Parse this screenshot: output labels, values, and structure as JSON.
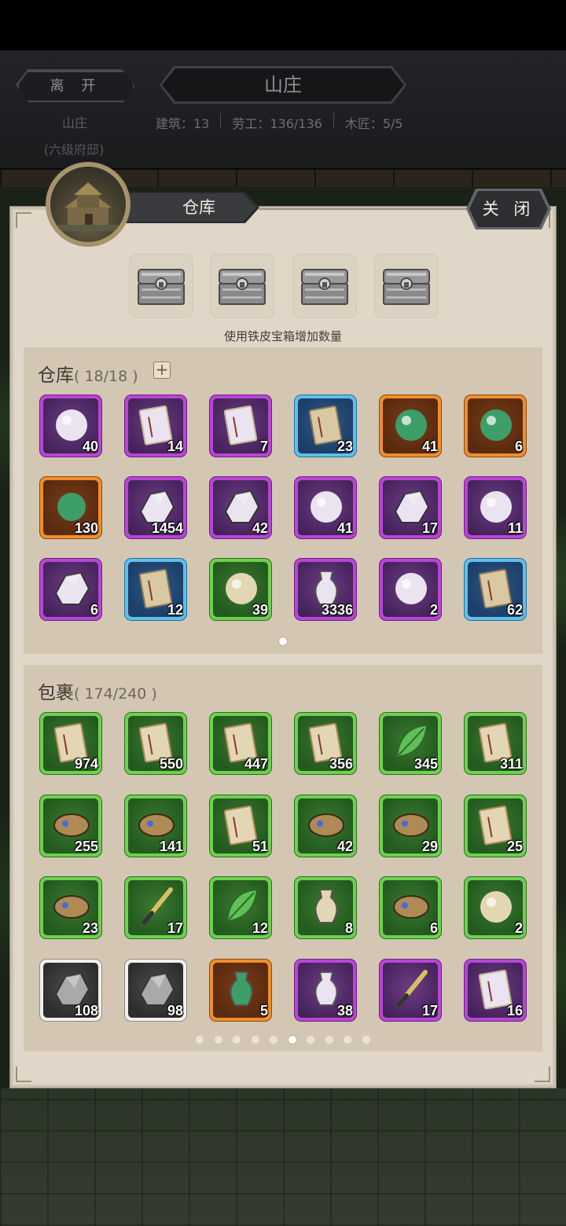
{
  "header": {
    "leave_label": "离 开",
    "location_title": "山庄",
    "location_name": "山庄",
    "location_level": "(六级府邸)",
    "stats": [
      "建筑：13",
      "劳工：136/136",
      "木匠：5/5"
    ]
  },
  "panel": {
    "title": "仓库",
    "close_label": "关 闭",
    "chest_hint": "使用铁皮宝箱增加数量",
    "chest_icon": "iron-chest-icon"
  },
  "warehouse": {
    "title": "仓库",
    "count": "( 18/18 )",
    "add_label": "+",
    "page_dots": 1,
    "active_dot": 0,
    "items": [
      {
        "name": "pearl",
        "rarity": "purple",
        "count": "40"
      },
      {
        "name": "red-book",
        "rarity": "purple",
        "count": "14"
      },
      {
        "name": "manual-books",
        "rarity": "purple",
        "count": "7"
      },
      {
        "name": "old-scroll",
        "rarity": "blue",
        "count": "23"
      },
      {
        "name": "jade-bead-cloth",
        "rarity": "orange",
        "count": "41"
      },
      {
        "name": "amber-orb",
        "rarity": "orange",
        "count": "6"
      },
      {
        "name": "silver-ring",
        "rarity": "orange",
        "count": "130"
      },
      {
        "name": "dark-ore",
        "rarity": "purple",
        "count": "1454"
      },
      {
        "name": "iron-ore",
        "rarity": "purple",
        "count": "42"
      },
      {
        "name": "gold-egg",
        "rarity": "purple",
        "count": "41"
      },
      {
        "name": "silver-shards",
        "rarity": "purple",
        "count": "17"
      },
      {
        "name": "steel-ball",
        "rarity": "purple",
        "count": "11"
      },
      {
        "name": "red-crystal",
        "rarity": "purple",
        "count": "6"
      },
      {
        "name": "paper-manual",
        "rarity": "blue",
        "count": "12"
      },
      {
        "name": "jade-pendant",
        "rarity": "green",
        "count": "39"
      },
      {
        "name": "gold-nugget",
        "rarity": "purple",
        "count": "3336"
      },
      {
        "name": "white-jade",
        "rarity": "purple",
        "count": "2"
      },
      {
        "name": "gold-scroll",
        "rarity": "blue",
        "count": "62"
      }
    ]
  },
  "bag": {
    "title": "包裹",
    "count": "( 174/240 )",
    "page_dots": 10,
    "active_dot": 5,
    "items": [
      {
        "name": "manual-a",
        "rarity": "green",
        "count": "974"
      },
      {
        "name": "manual-b",
        "rarity": "green",
        "count": "550"
      },
      {
        "name": "manual-c",
        "rarity": "green",
        "count": "447"
      },
      {
        "name": "manual-d",
        "rarity": "green",
        "count": "356"
      },
      {
        "name": "herb-leaf",
        "rarity": "green",
        "count": "345"
      },
      {
        "name": "scroll-book",
        "rarity": "green",
        "count": "311"
      },
      {
        "name": "gem-cloth",
        "rarity": "green",
        "count": "255"
      },
      {
        "name": "cloth-bundle",
        "rarity": "green",
        "count": "141"
      },
      {
        "name": "manual-e",
        "rarity": "green",
        "count": "51"
      },
      {
        "name": "leather",
        "rarity": "green",
        "count": "42"
      },
      {
        "name": "beef",
        "rarity": "green",
        "count": "29"
      },
      {
        "name": "map",
        "rarity": "green",
        "count": "25"
      },
      {
        "name": "fish",
        "rarity": "green",
        "count": "23"
      },
      {
        "name": "brush",
        "rarity": "green",
        "count": "17"
      },
      {
        "name": "bamboo",
        "rarity": "green",
        "count": "12"
      },
      {
        "name": "spice-bowl",
        "rarity": "green",
        "count": "8"
      },
      {
        "name": "bird",
        "rarity": "green",
        "count": "6"
      },
      {
        "name": "silver-jar",
        "rarity": "green",
        "count": "2"
      },
      {
        "name": "rubble",
        "rarity": "white",
        "count": "108"
      },
      {
        "name": "iron-ingot",
        "rarity": "white",
        "count": "98"
      },
      {
        "name": "gold-token",
        "rarity": "orange",
        "count": "5"
      },
      {
        "name": "porcelain-vase",
        "rarity": "purple",
        "count": "38"
      },
      {
        "name": "golden-blade",
        "rarity": "purple",
        "count": "17"
      },
      {
        "name": "sketch-paper",
        "rarity": "purple",
        "count": "16"
      }
    ]
  }
}
